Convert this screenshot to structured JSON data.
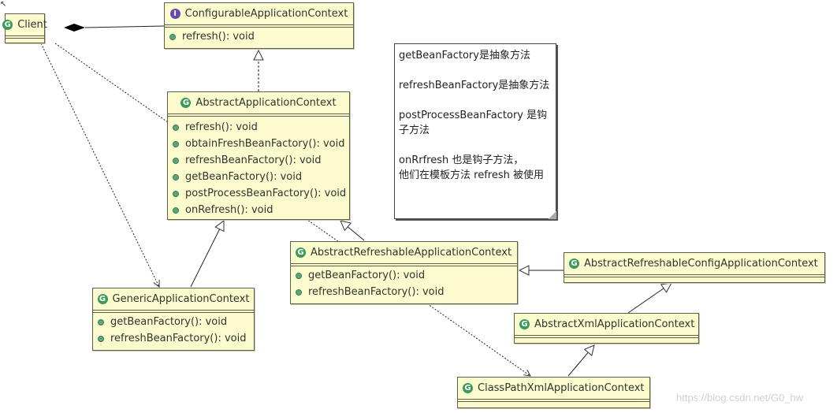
{
  "diagram": {
    "type": "UML class diagram",
    "classes": {
      "client": {
        "name": "Client",
        "kind": "class",
        "methods": []
      },
      "configurable": {
        "name": "ConfigurableApplicationContext",
        "kind": "interface",
        "methods": [
          "refresh(): void"
        ]
      },
      "abstract_app": {
        "name": "AbstractApplicationContext",
        "kind": "class",
        "methods": [
          "refresh(): void",
          "obtainFreshBeanFactory(): void",
          "refreshBeanFactory(): void",
          "getBeanFactory(): void",
          "postProcessBeanFactory(): void",
          "onRefresh(): void"
        ]
      },
      "generic": {
        "name": "GenericApplicationContext",
        "kind": "class",
        "methods": [
          "getBeanFactory(): void",
          "refreshBeanFactory(): void"
        ]
      },
      "abstract_refreshable": {
        "name": "AbstractRefreshableApplicationContext",
        "kind": "class",
        "methods": [
          "getBeanFactory(): void",
          "refreshBeanFactory(): void"
        ]
      },
      "abstract_refreshable_config": {
        "name": "AbstractRefreshableConfigApplicationContext",
        "kind": "class",
        "methods": []
      },
      "abstract_xml": {
        "name": "AbstractXmlApplicationContext",
        "kind": "class",
        "methods": []
      },
      "classpath_xml": {
        "name": "ClassPathXmlApplicationContext",
        "kind": "class",
        "methods": []
      }
    },
    "badges": {
      "class": "G",
      "interface": "I"
    },
    "relations": [
      {
        "from": "Client",
        "to": "ConfigurableApplicationContext",
        "type": "composition"
      },
      {
        "from": "AbstractApplicationContext",
        "to": "ConfigurableApplicationContext",
        "type": "realization"
      },
      {
        "from": "GenericApplicationContext",
        "to": "AbstractApplicationContext",
        "type": "generalization"
      },
      {
        "from": "AbstractRefreshableApplicationContext",
        "to": "AbstractApplicationContext",
        "type": "generalization"
      },
      {
        "from": "AbstractRefreshableConfigApplicationContext",
        "to": "AbstractRefreshableApplicationContext",
        "type": "generalization"
      },
      {
        "from": "AbstractXmlApplicationContext",
        "to": "AbstractRefreshableConfigApplicationContext",
        "type": "generalization"
      },
      {
        "from": "ClassPathXmlApplicationContext",
        "to": "AbstractXmlApplicationContext",
        "type": "generalization"
      },
      {
        "from": "Client",
        "to": "GenericApplicationContext",
        "type": "dependency"
      },
      {
        "from": "Client",
        "to": "ClassPathXmlApplicationContext",
        "type": "dependency"
      }
    ],
    "note": {
      "lines": [
        "getBeanFactory是抽象方法",
        "refreshBeanFactory是抽象方法",
        "postProcessBeanFactory 是钩子方法",
        "onRrfresh 也是钩子方法，\n他们在模板方法 refresh 被使用"
      ]
    },
    "watermark": "https://blog.csdn.net/G0_hw",
    "colors": {
      "class_fill": "#fbfbcd",
      "border": "#5e5e4a",
      "class_badge": "#3a9a5c",
      "interface_badge": "#6a48b0",
      "method_dot": "#5aa57a"
    }
  }
}
